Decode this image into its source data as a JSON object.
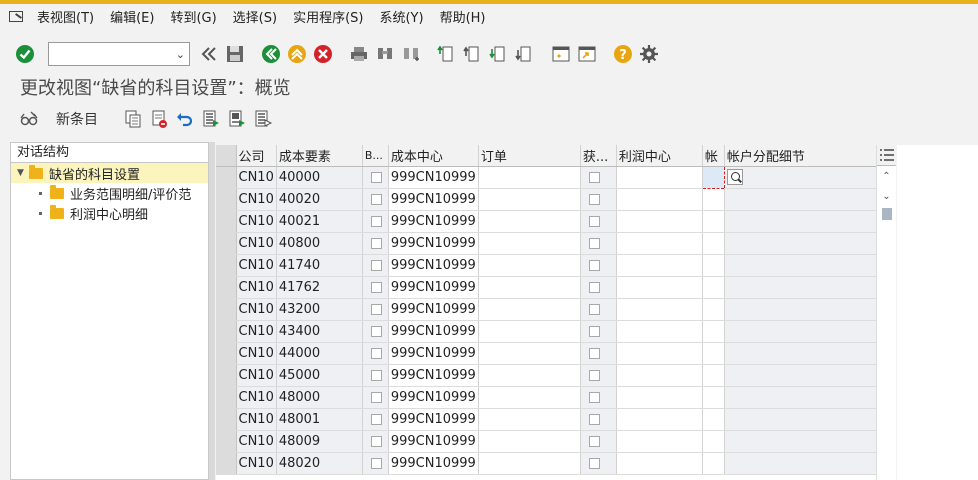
{
  "menu": {
    "items": [
      "表视图(T)",
      "编辑(E)",
      "转到(G)",
      "选择(S)",
      "实用程序(S)",
      "系统(Y)",
      "帮助(H)"
    ]
  },
  "toolbar": {
    "command_field_value": "",
    "icons": [
      "enter-check-icon",
      "back-double-arrow-icon",
      "save-icon",
      "back-icon",
      "exit-icon",
      "cancel-icon",
      "print-icon",
      "find-icon",
      "find-next-icon",
      "first-page-icon",
      "previous-page-icon",
      "next-page-icon",
      "last-page-icon",
      "new-session-icon",
      "shortcut-icon",
      "help-icon",
      "settings-gear-icon"
    ]
  },
  "page": {
    "title": "更改视图“缺省的科目设置”：概览"
  },
  "app_toolbar": {
    "new_entries_label": "新条目"
  },
  "tree": {
    "header": "对话结构",
    "root": "缺省的科目设置",
    "children": [
      "业务范围明细/评价范",
      "利润中心明细"
    ]
  },
  "grid": {
    "columns": [
      "公司",
      "成本要素",
      "B...",
      "成本中心",
      "订单",
      "获...",
      "利润中心",
      "帐",
      "帐户分配细节"
    ],
    "rows": [
      {
        "company": "CN10",
        "cost_element": "40000",
        "cost_center": "999CN10999"
      },
      {
        "company": "CN10",
        "cost_element": "40020",
        "cost_center": "999CN10999"
      },
      {
        "company": "CN10",
        "cost_element": "40021",
        "cost_center": "999CN10999"
      },
      {
        "company": "CN10",
        "cost_element": "40800",
        "cost_center": "999CN10999"
      },
      {
        "company": "CN10",
        "cost_element": "41740",
        "cost_center": "999CN10999"
      },
      {
        "company": "CN10",
        "cost_element": "41762",
        "cost_center": "999CN10999"
      },
      {
        "company": "CN10",
        "cost_element": "43200",
        "cost_center": "999CN10999"
      },
      {
        "company": "CN10",
        "cost_element": "43400",
        "cost_center": "999CN10999"
      },
      {
        "company": "CN10",
        "cost_element": "44000",
        "cost_center": "999CN10999"
      },
      {
        "company": "CN10",
        "cost_element": "45000",
        "cost_center": "999CN10999"
      },
      {
        "company": "CN10",
        "cost_element": "48000",
        "cost_center": "999CN10999"
      },
      {
        "company": "CN10",
        "cost_element": "48001",
        "cost_center": "999CN10999"
      },
      {
        "company": "CN10",
        "cost_element": "48009",
        "cost_center": "999CN10999"
      },
      {
        "company": "CN10",
        "cost_element": "48020",
        "cost_center": "999CN10999"
      }
    ]
  },
  "colors": {
    "accent_stripe": "#e8b21a",
    "enter_green": "#1b8f3a",
    "nav_green": "#1b8f3a",
    "exit_yellow": "#e8a512",
    "cancel_red": "#d3222a",
    "help_yellow": "#e8a512",
    "folder": "#f0b21a",
    "selected_tree_row": "#fbf5bd",
    "readonly_cell": "#eef0f3",
    "focus_border": "#d02020"
  }
}
